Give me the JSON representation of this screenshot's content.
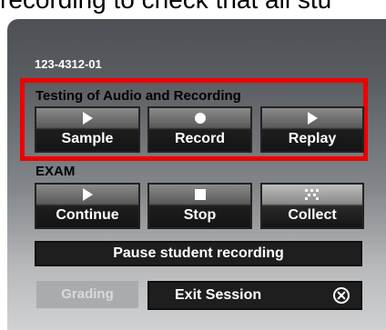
{
  "page_text": "recording to check that all stu",
  "session_id": "123-4312-01",
  "testing": {
    "title": "Testing of Audio and Recording",
    "sample_label": "Sample",
    "record_label": "Record",
    "replay_label": "Replay"
  },
  "exam": {
    "title": "EXAM",
    "continue_label": "Continue",
    "stop_label": "Stop",
    "collect_label": "Collect"
  },
  "pause_label": "Pause student recording",
  "grading_label": "Grading",
  "exit_label": "Exit Session",
  "colors": {
    "highlight_frame": "#ee0000",
    "button_dark": "#1e1e1e",
    "disabled_button": "#a9abae"
  }
}
